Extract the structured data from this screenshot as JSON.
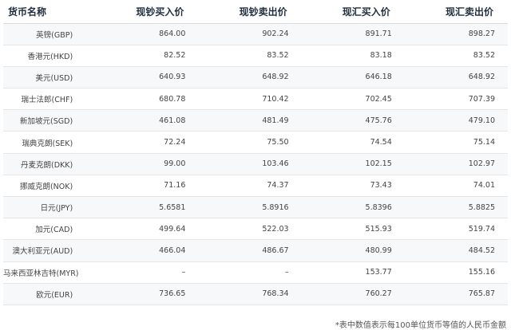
{
  "table": {
    "headers": [
      "货币名称",
      "现钞买入价",
      "现钞卖出价",
      "现汇买入价",
      "现汇卖出价"
    ],
    "rows": [
      [
        "英镑(GBP)",
        "864.00",
        "902.24",
        "891.71",
        "898.27"
      ],
      [
        "香港元(HKD)",
        "82.52",
        "83.52",
        "83.18",
        "83.52"
      ],
      [
        "美元(USD)",
        "640.93",
        "648.92",
        "646.18",
        "648.92"
      ],
      [
        "瑞士法郎(CHF)",
        "680.78",
        "710.42",
        "702.45",
        "707.39"
      ],
      [
        "新加坡元(SGD)",
        "461.08",
        "481.49",
        "475.76",
        "479.10"
      ],
      [
        "瑞典克朗(SEK)",
        "72.24",
        "75.50",
        "74.54",
        "75.14"
      ],
      [
        "丹麦克朗(DKK)",
        "99.00",
        "103.46",
        "102.15",
        "102.97"
      ],
      [
        "挪威克朗(NOK)",
        "71.16",
        "74.37",
        "73.43",
        "74.01"
      ],
      [
        "日元(JPY)",
        "5.6581",
        "5.8916",
        "5.8396",
        "5.8825"
      ],
      [
        "加元(CAD)",
        "499.64",
        "522.03",
        "515.93",
        "519.74"
      ],
      [
        "澳大利亚元(AUD)",
        "466.04",
        "486.67",
        "480.99",
        "484.52"
      ],
      [
        "马来西亚林吉特(MYR)",
        "–",
        "–",
        "153.77",
        "155.16"
      ],
      [
        "欧元(EUR)",
        "736.65",
        "768.34",
        "760.27",
        "765.87"
      ]
    ]
  },
  "footnote": "*表中数值表示每100单位货币等值的人民币金额"
}
